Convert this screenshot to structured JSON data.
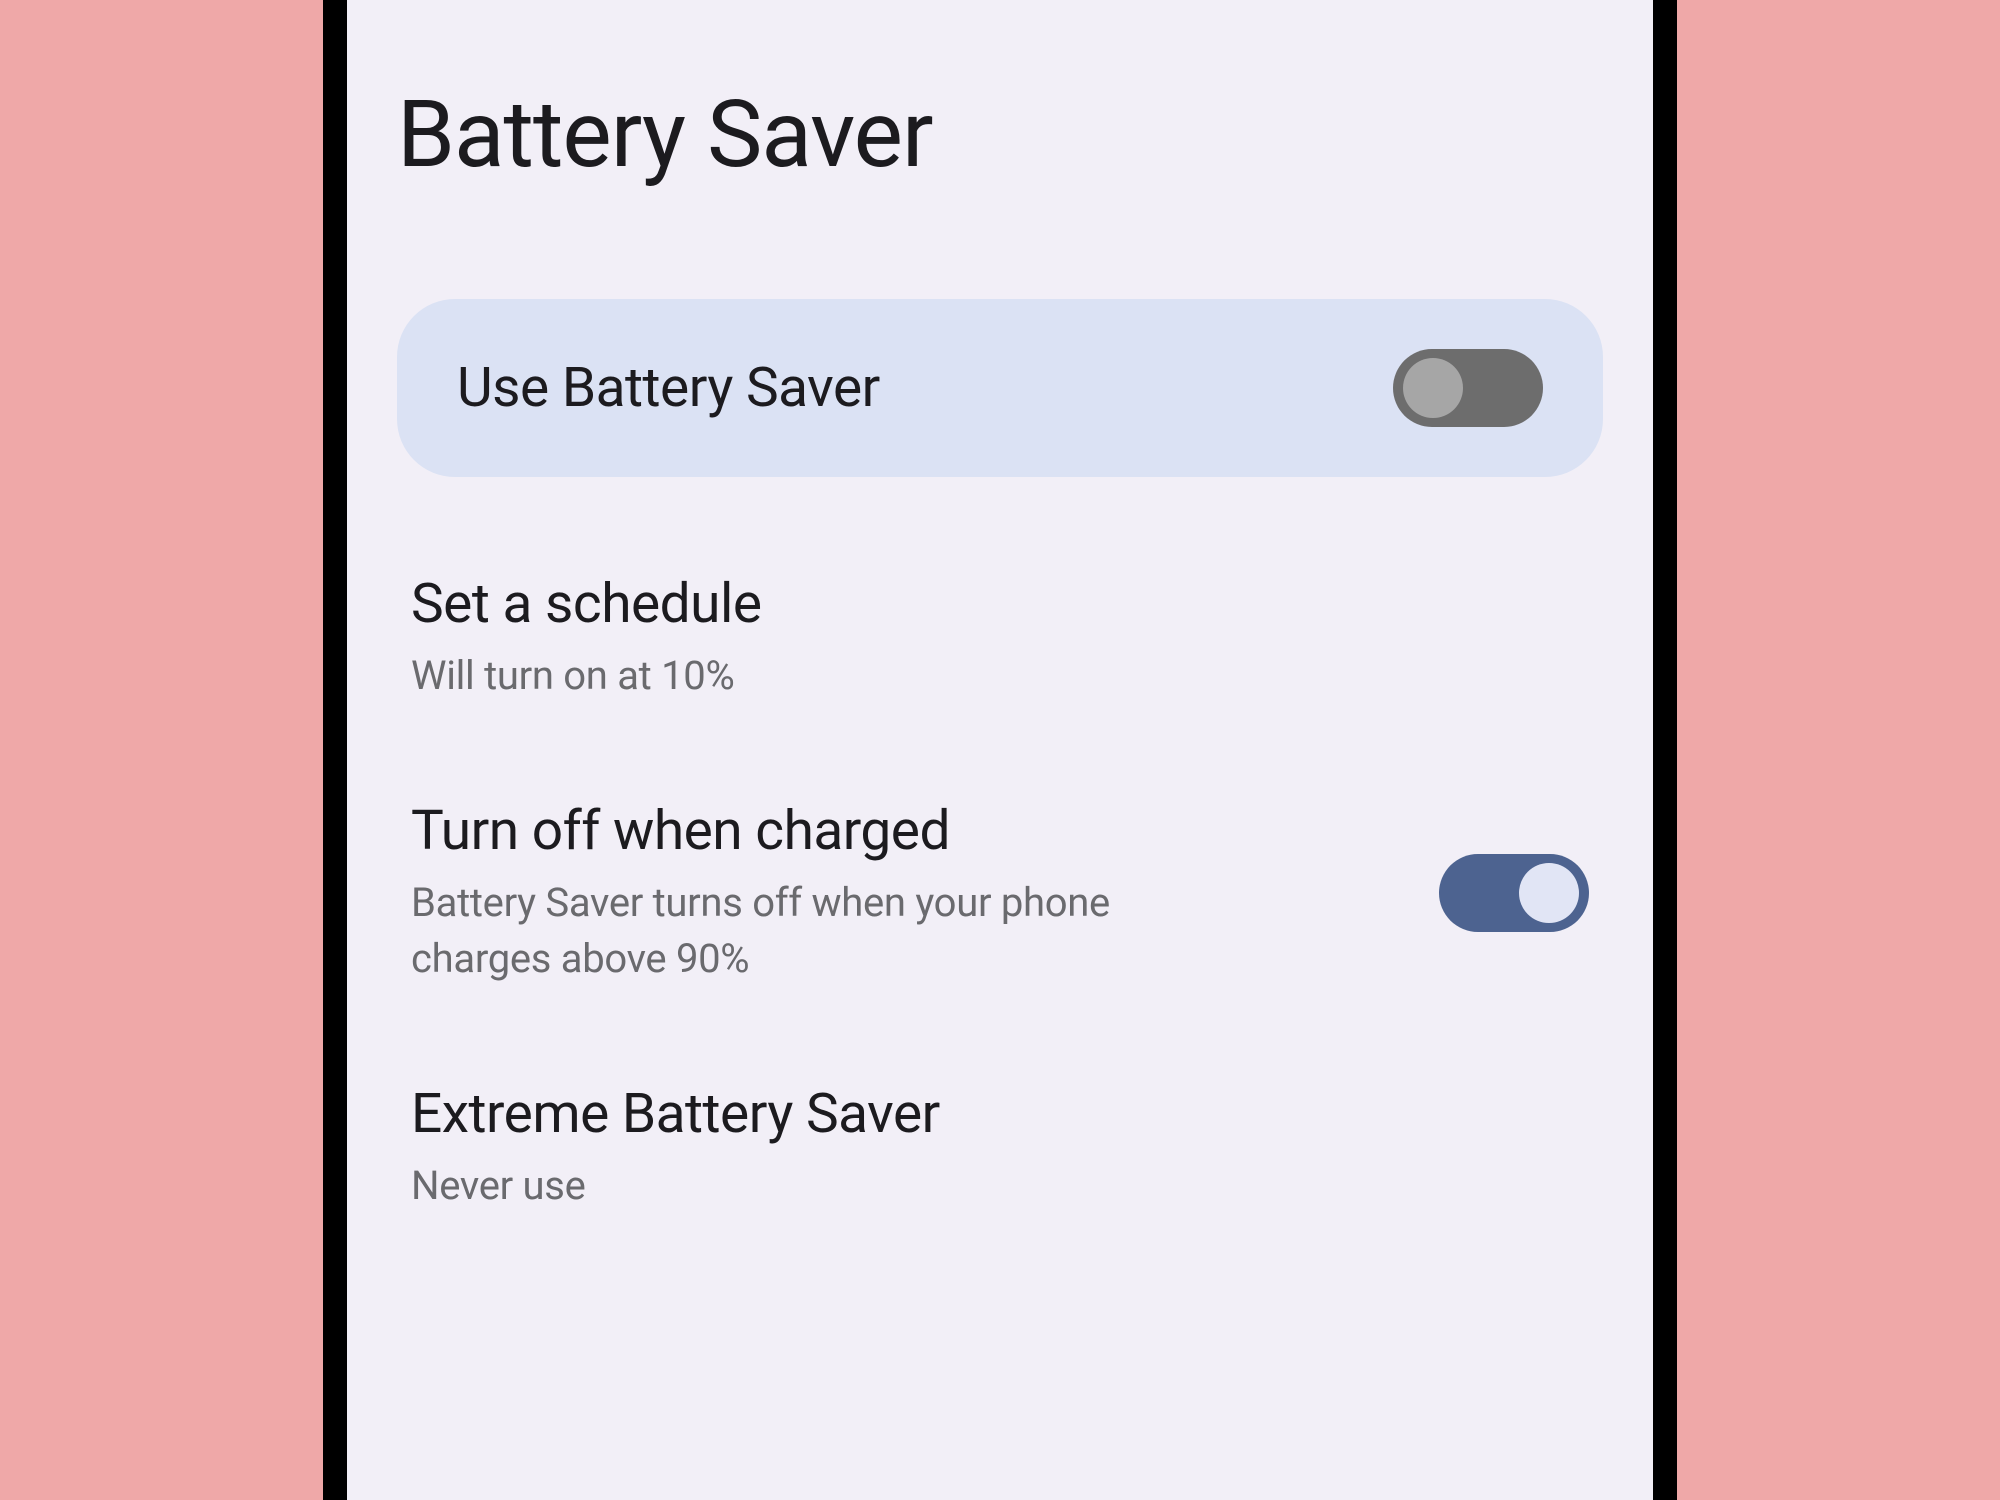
{
  "page": {
    "title": "Battery Saver"
  },
  "hero": {
    "label": "Use Battery Saver",
    "toggle_state": "off"
  },
  "settings": [
    {
      "title": "Set a schedule",
      "subtitle": "Will turn on at 10%",
      "has_toggle": false
    },
    {
      "title": "Turn off when charged",
      "subtitle": "Battery Saver turns off when your phone charges above 90%",
      "has_toggle": true,
      "toggle_state": "on"
    },
    {
      "title": "Extreme Battery Saver",
      "subtitle": "Never use",
      "has_toggle": false
    }
  ],
  "colors": {
    "background": "#efa8a8",
    "screen": "#f2eff7",
    "hero_card": "#dbe2f4",
    "text_primary": "#1c1b1f",
    "text_secondary": "#6a6a6e",
    "toggle_on": "#4d6390",
    "toggle_off": "#6d6d6d"
  }
}
